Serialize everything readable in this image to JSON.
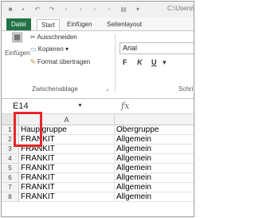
{
  "window": {
    "title_fragment": "C:\\Users\\Ver"
  },
  "ribbon_tabs": [
    "Datei",
    "Start",
    "Einfügen",
    "Seitenlayout"
  ],
  "clipboard": {
    "paste_label": "Einfügen",
    "cut_label": "Ausschneiden",
    "copy_label": "Kopieren",
    "format_painter_label": "Format übertragen",
    "group_label": "Zwischenablage"
  },
  "font": {
    "name": "Arial",
    "bold": "F",
    "italic": "K",
    "underline": "U",
    "group_label": "Schri"
  },
  "formula_bar": {
    "name_box": "E14",
    "fx": "fx"
  },
  "grid": {
    "columns": [
      "A",
      ""
    ],
    "rows": [
      {
        "num": "1",
        "a": "Hauptgruppe",
        "b": "Obergruppe"
      },
      {
        "num": "2",
        "a": "FRANKIT",
        "b": "Allgemein"
      },
      {
        "num": "3",
        "a": "FRANKIT",
        "b": "Allgemein"
      },
      {
        "num": "4",
        "a": "FRANKIT",
        "b": "Allgemein"
      },
      {
        "num": "5",
        "a": "FRANKIT",
        "b": "Allgemein"
      },
      {
        "num": "6",
        "a": "FRANKIT",
        "b": "Allgemein"
      },
      {
        "num": "7",
        "a": "FRANKIT",
        "b": "Allgemein"
      },
      {
        "num": "8",
        "a": "FRANKIT",
        "b": "Allgemein"
      }
    ]
  },
  "colors": {
    "file_tab": "#217346",
    "highlight": "#e8262a"
  }
}
